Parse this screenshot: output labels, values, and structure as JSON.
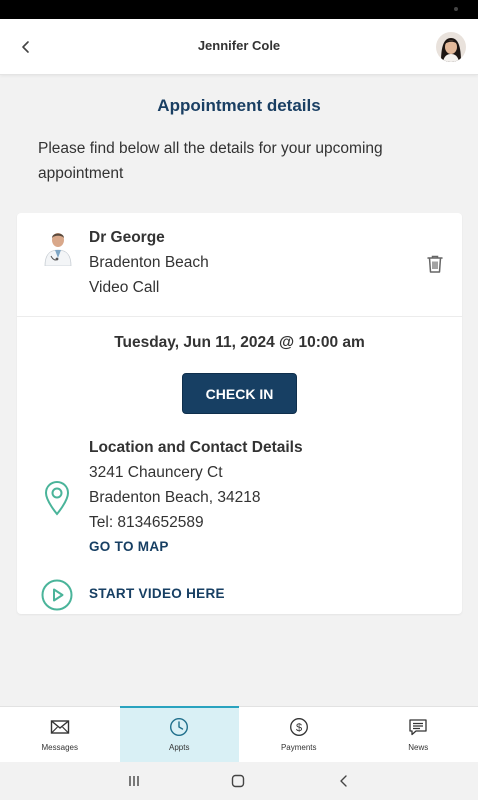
{
  "header": {
    "title": "Jennifer Cole",
    "back_icon": "chevron-left-icon",
    "avatar_icon": "user-avatar"
  },
  "page": {
    "heading": "Appointment details",
    "intro": "Please find below all the details for your upcoming appointment"
  },
  "appointment": {
    "doctor_name": "Dr George",
    "location_name": "Bradenton Beach",
    "visit_type": "Video Call",
    "datetime": "Tuesday, Jun 11, 2024 @ 10:00 am",
    "check_in_label": "CHECK IN",
    "contact": {
      "title": "Location and Contact Details",
      "address_line1": "3241 Chauncery Ct",
      "address_line2": "Bradenton Beach, 34218",
      "phone": "Tel: 8134652589",
      "map_link": "GO TO MAP"
    },
    "video_link": "START VIDEO HERE"
  },
  "bottom_nav": {
    "items": [
      {
        "label": "Messages",
        "icon": "envelope-icon",
        "active": false
      },
      {
        "label": "Appts",
        "icon": "clock-icon",
        "active": true
      },
      {
        "label": "Payments",
        "icon": "dollar-circle-icon",
        "active": false
      },
      {
        "label": "News",
        "icon": "chat-icon",
        "active": false
      }
    ]
  },
  "colors": {
    "brand_navy": "#173f63",
    "accent_teal": "#4ab49a",
    "active_tab_bg": "#d9f0f5",
    "active_tab_bar": "#2aa3bf"
  }
}
